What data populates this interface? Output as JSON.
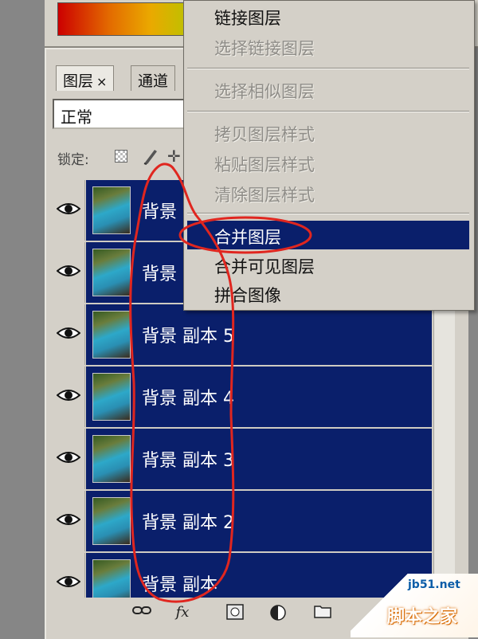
{
  "tabs": [
    {
      "label": "图层",
      "close": "×"
    },
    {
      "label": "通道"
    }
  ],
  "blend_mode": "正常",
  "lock_label": "锁定:",
  "layers": [
    {
      "name": "背景"
    },
    {
      "name": "背景"
    },
    {
      "name": "背景 副本 5"
    },
    {
      "name": "背景 副本 4"
    },
    {
      "name": "背景 副本 3"
    },
    {
      "name": "背景 副本 2"
    },
    {
      "name": "背景 副本"
    }
  ],
  "menu": {
    "items": [
      {
        "label": "链接图层",
        "state": "enabled"
      },
      {
        "label": "选择链接图层",
        "state": "disabled"
      },
      {
        "label": "选择相似图层",
        "state": "disabled"
      },
      {
        "label": "拷贝图层样式",
        "state": "disabled"
      },
      {
        "label": "粘贴图层样式",
        "state": "disabled"
      },
      {
        "label": "清除图层样式",
        "state": "disabled"
      },
      {
        "label": "合并图层",
        "state": "highlighted"
      },
      {
        "label": "合并可见图层",
        "state": "enabled"
      },
      {
        "label": "拼合图像",
        "state": "enabled"
      }
    ]
  },
  "footer_icons": [
    "link-icon",
    "fx-icon",
    "mask-icon",
    "adjustment-icon",
    "folder-icon"
  ],
  "footer_fx": "fx",
  "watermark": {
    "site": "jb51.net",
    "brand": "脚本之家"
  },
  "colors": {
    "selection": "#0a1f6b",
    "panel": "#d4d0c8",
    "annotation": "#e0261f"
  }
}
